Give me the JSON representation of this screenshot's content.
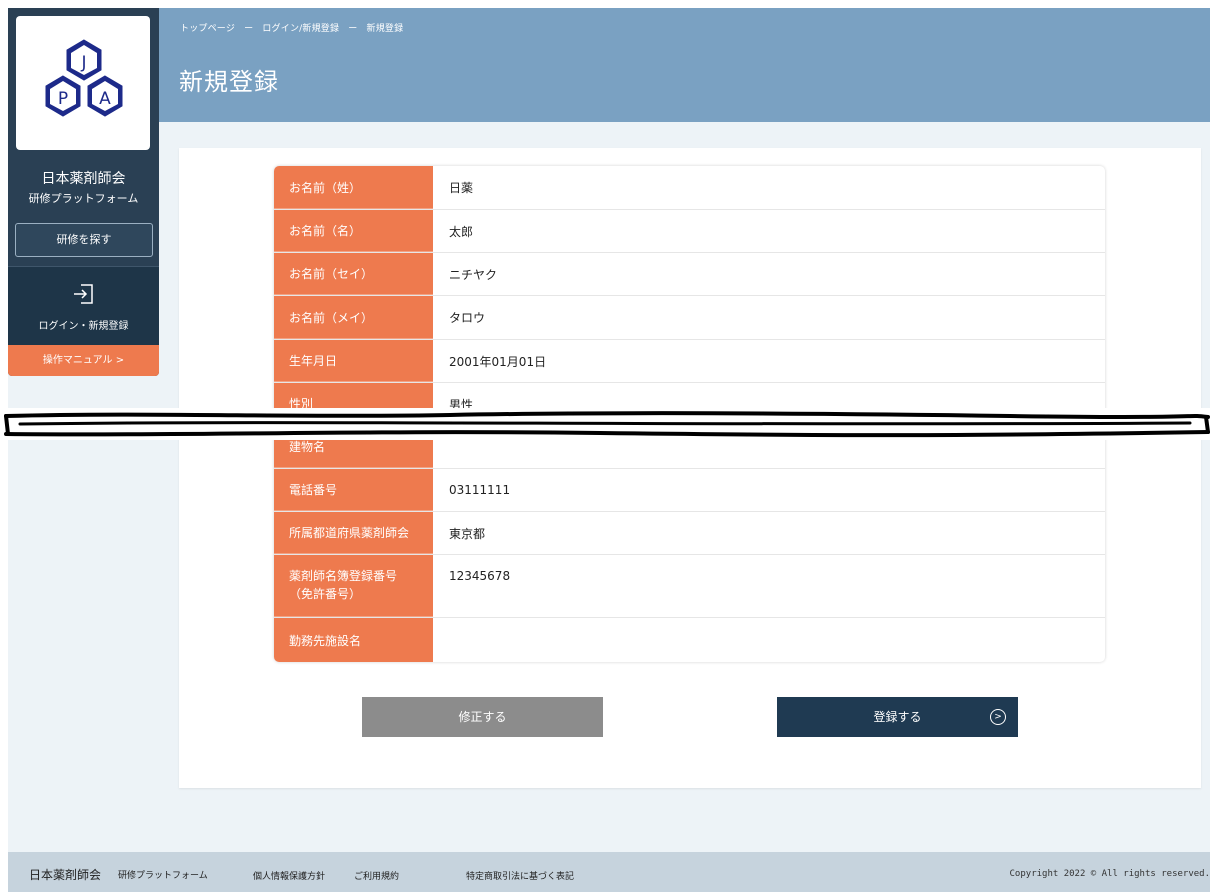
{
  "header": {
    "breadcrumb": [
      "トップページ",
      "ー",
      "ログイン/新規登録",
      "ー",
      "新規登録"
    ],
    "title": "新規登録"
  },
  "sidebar": {
    "logo_letters": [
      "J",
      "P",
      "A"
    ],
    "org_name": "日本薬剤師会",
    "org_sub": "研修プラットフォーム",
    "search_button": "研修を探す",
    "login_label": "ログイン・新規登録",
    "manual_link": "操作マニュアル >"
  },
  "form": {
    "rows": [
      {
        "label": "お名前（姓）",
        "value": "日薬"
      },
      {
        "label": "お名前（名）",
        "value": "太郎"
      },
      {
        "label": "お名前（セイ）",
        "value": "ニチヤク"
      },
      {
        "label": "お名前（メイ）",
        "value": "タロウ"
      },
      {
        "label": "生年月日",
        "value": "2001年01月01日"
      },
      {
        "label": "性別",
        "value": "男性"
      },
      {
        "label": "建物名",
        "value": ""
      },
      {
        "label": "電話番号",
        "value": "03111111"
      },
      {
        "label": "所属都道府県薬剤師会",
        "value": "東京都"
      },
      {
        "label": "薬剤師名簿登録番号\n（免許番号）",
        "value": "12345678"
      },
      {
        "label": "勤務先施設名",
        "value": ""
      }
    ]
  },
  "buttons": {
    "edit": "修正する",
    "register": "登録する",
    "register_icon": ">"
  },
  "footer": {
    "org_name": "日本薬剤師会",
    "org_sub": "研修プラットフォーム",
    "links": [
      "個人情報保護方針",
      "ご利用規約",
      "特定商取引法に基づく表記"
    ],
    "copyright": "Copyright 2022 © All rights reserved."
  },
  "colors": {
    "header": "#7aa1c2",
    "sidebar": "#2a4054",
    "accent_orange": "#ee7a4e",
    "register_button": "#1f3a52",
    "edit_button": "#8c8c8c",
    "footer": "#c6d3dd"
  }
}
